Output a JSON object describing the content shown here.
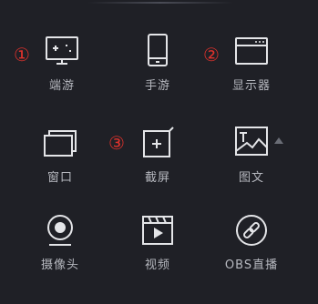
{
  "colors": {
    "background": "#1f2026",
    "icon": "#e4e5e8",
    "label": "#b6b8bf",
    "marker": "#e0322c"
  },
  "markers": {
    "m1": "①",
    "m2": "②",
    "m3": "③"
  },
  "items": [
    {
      "label": "端游",
      "icon": "gamepad-monitor-icon"
    },
    {
      "label": "手游",
      "icon": "phone-icon"
    },
    {
      "label": "显示器",
      "icon": "browser-window-icon"
    },
    {
      "label": "窗口",
      "icon": "stacked-window-icon"
    },
    {
      "label": "截屏",
      "icon": "crop-add-icon"
    },
    {
      "label": "图文",
      "icon": "image-text-icon"
    },
    {
      "label": "摄像头",
      "icon": "webcam-icon"
    },
    {
      "label": "视频",
      "icon": "clapperboard-icon"
    },
    {
      "label": "OBS直播",
      "icon": "link-icon"
    }
  ]
}
